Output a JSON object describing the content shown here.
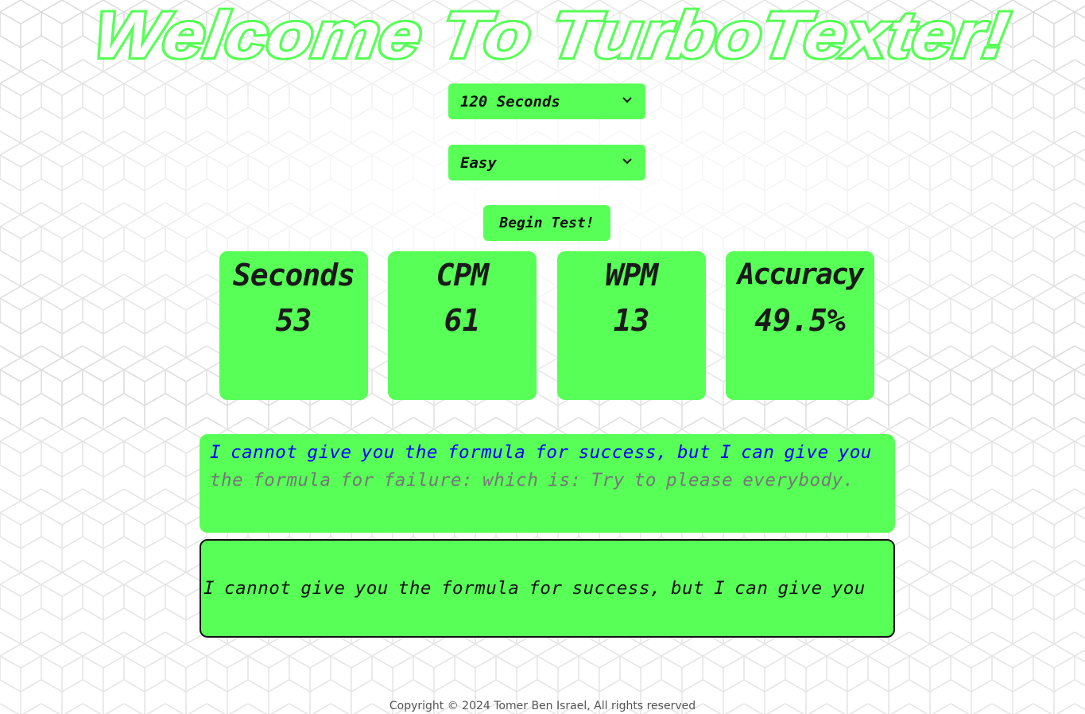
{
  "header": {
    "title": "Welcome To TurboTexter!"
  },
  "controls": {
    "time_select": "120 Seconds",
    "difficulty_select": "Easy",
    "begin_button": "Begin Test!"
  },
  "stats": {
    "seconds": {
      "label": "Seconds",
      "value": "53"
    },
    "cpm": {
      "label": "CPM",
      "value": "61"
    },
    "wpm": {
      "label": "WPM",
      "value": "13"
    },
    "accuracy": {
      "label": "Accuracy",
      "value": "49.5%"
    }
  },
  "quote": {
    "typed": "I cannot give you the formula for success, but I can give you",
    "remaining": " the formula for failure: which is: Try to please everybody."
  },
  "typing_input": {
    "value": "I cannot give you the formula for success, but I can give you"
  },
  "footer": {
    "copyright": "Copyright © 2024 Tomer Ben Israel, All rights reserved"
  },
  "colors": {
    "accent_green": "#57ff57",
    "typed_text": "#0000ff",
    "remaining_text": "#777777"
  }
}
